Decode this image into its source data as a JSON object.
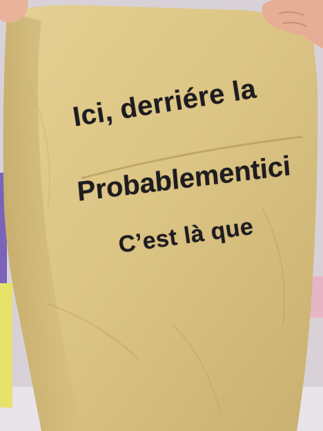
{
  "shirt": {
    "color": "#dcc585",
    "text_lines": [
      "Ici, derriére la",
      "Probablementici",
      "C’est là que"
    ]
  }
}
